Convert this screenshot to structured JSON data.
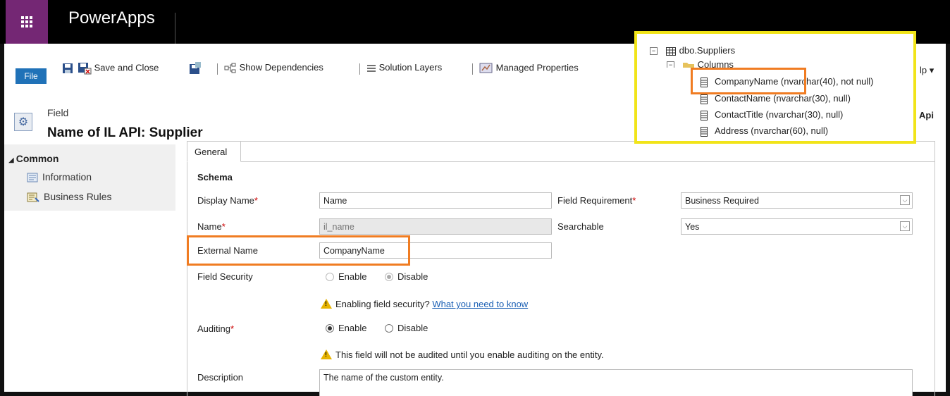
{
  "app": {
    "title": "PowerApps"
  },
  "toolbar": {
    "file_label": "File",
    "save_close_label": "Save and Close",
    "show_dependencies_label": "Show Dependencies",
    "solution_layers_label": "Solution Layers",
    "managed_properties_label": "Managed Properties",
    "help_label": "lp ▾"
  },
  "header": {
    "type_label": "Field",
    "title": "Name of IL API: Supplier",
    "right_cut_text": "Api"
  },
  "nav": {
    "section": "Common",
    "items": [
      {
        "label": "Information"
      },
      {
        "label": "Business Rules"
      }
    ]
  },
  "tabs": [
    {
      "label": "General"
    }
  ],
  "form": {
    "section_title": "Schema",
    "display_name": {
      "label": "Display Name",
      "value": "Name"
    },
    "name": {
      "label": "Name",
      "value": "il_name"
    },
    "external_name": {
      "label": "External Name",
      "value": "CompanyName"
    },
    "field_requirement": {
      "label": "Field Requirement",
      "value": "Business Required"
    },
    "searchable": {
      "label": "Searchable",
      "value": "Yes"
    },
    "field_security": {
      "label": "Field Security",
      "options": [
        "Enable",
        "Disable"
      ],
      "selected": "Disable",
      "warning": "Enabling field security?",
      "link": "What you need to know"
    },
    "auditing": {
      "label": "Auditing",
      "options": [
        "Enable",
        "Disable"
      ],
      "selected": "Enable",
      "warning": "This field will not be audited until you enable auditing on the entity."
    },
    "description": {
      "label": "Description",
      "value": "The name of the custom entity."
    },
    "required_marker": "*"
  },
  "tree_overlay": {
    "table": "dbo.Suppliers",
    "folder": "Columns",
    "columns": [
      "CompanyName (nvarchar(40), not null)",
      "ContactName (nvarchar(30), null)",
      "ContactTitle (nvarchar(30), null)",
      "Address (nvarchar(60), null)"
    ]
  },
  "colors": {
    "waffle_bg": "#742774",
    "file_button": "#2072b8",
    "highlight_orange": "#f07c22",
    "highlight_yellow": "#f1e419",
    "required": "#c00000",
    "link": "#1a5fb4"
  }
}
